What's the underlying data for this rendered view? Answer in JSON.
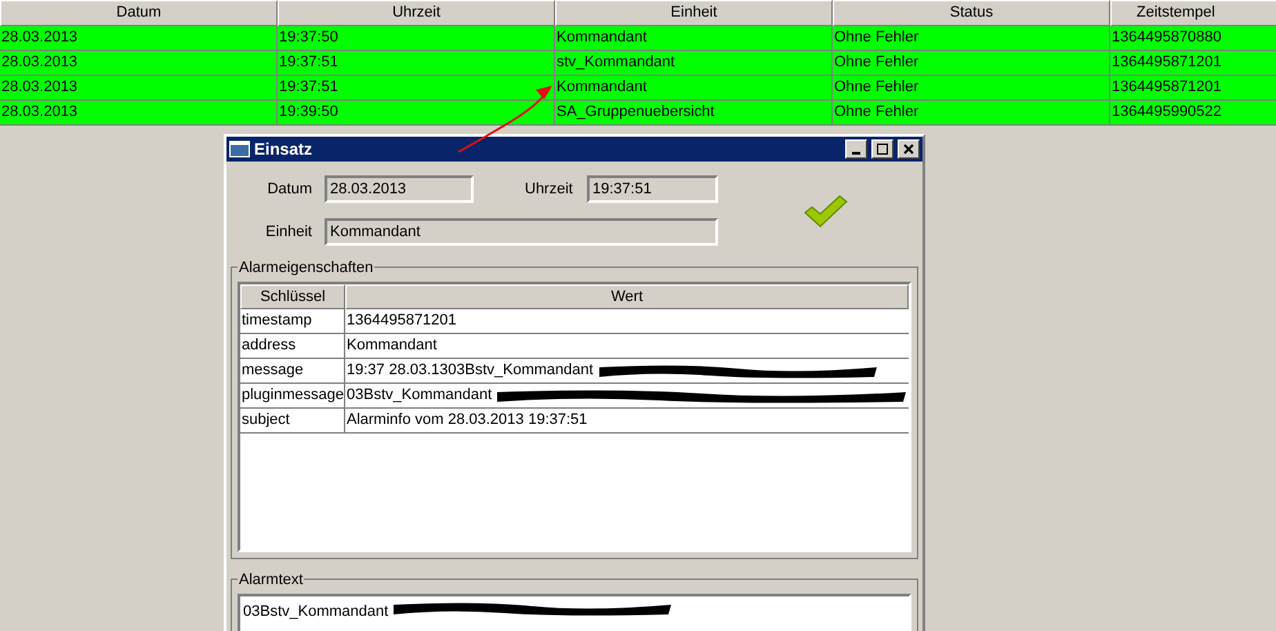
{
  "table": {
    "columns": [
      "Datum",
      "Uhrzeit",
      "Einheit",
      "Status",
      "Zeitstempel"
    ],
    "rows": [
      {
        "cells": [
          "28.03.2013",
          "19:37:50",
          "Kommandant",
          "Ohne Fehler",
          "1364495870880"
        ]
      },
      {
        "cells": [
          "28.03.2013",
          "19:37:51",
          "stv_Kommandant",
          "Ohne Fehler",
          "1364495871201"
        ]
      },
      {
        "cells": [
          "28.03.2013",
          "19:37:51",
          "Kommandant",
          "Ohne Fehler",
          "1364495871201"
        ]
      },
      {
        "cells": [
          "28.03.2013",
          "19:39:50",
          "SA_Gruppenuebersicht",
          "Ohne Fehler",
          "1364495990522"
        ]
      }
    ]
  },
  "dialog": {
    "title": "Einsatz",
    "fields": [
      {
        "label": "Datum",
        "value": "28.03.2013"
      },
      {
        "label": "Uhrzeit",
        "value": "19:37:51"
      },
      {
        "label": "Einheit",
        "value": "Kommandant"
      }
    ],
    "properties": {
      "title": "Alarmeigenschaften",
      "columns": [
        "Schlüssel",
        "Wert"
      ],
      "rows": [
        {
          "key": "timestamp",
          "value": "1364495871201",
          "redacted": false
        },
        {
          "key": "address",
          "value": "Kommandant",
          "redacted": false
        },
        {
          "key": "message",
          "value": "19:37 28.03.1303Bstv_Kommandant",
          "redacted": true
        },
        {
          "key": "pluginmessage",
          "value": "03Bstv_Kommandant",
          "redacted": true
        },
        {
          "key": "subject",
          "value": "Alarminfo vom 28.03.2013 19:37:51",
          "redacted": false
        }
      ]
    },
    "alarmtext": {
      "title": "Alarmtext",
      "value": "03Bstv_Kommandant",
      "redacted": true
    }
  }
}
